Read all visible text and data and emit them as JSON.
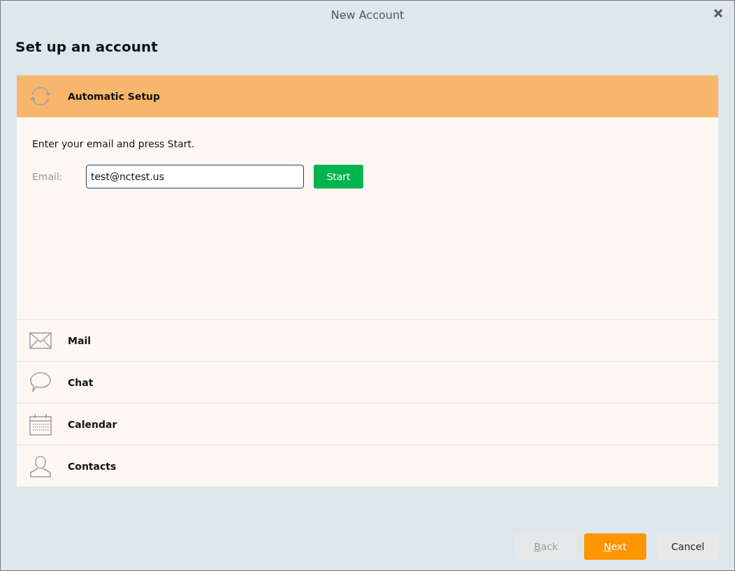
{
  "window": {
    "title": "New Account"
  },
  "heading": "Set up an account",
  "sections": [
    {
      "kind": "auto",
      "label": "Automatic Setup",
      "selected": true
    },
    {
      "kind": "mail",
      "label": "Mail",
      "selected": false
    },
    {
      "kind": "chat",
      "label": "Chat",
      "selected": false
    },
    {
      "kind": "calendar",
      "label": "Calendar",
      "selected": false
    },
    {
      "kind": "contacts",
      "label": "Contacts",
      "selected": false
    }
  ],
  "auto_setup": {
    "instruction": "Enter your email and press Start.",
    "email_label": "Email:",
    "email_value": "test@nctest.us",
    "start_button": "Start"
  },
  "buttons": [
    {
      "label": "Back",
      "kind": "back",
      "disabled": true,
      "underline_first": true
    },
    {
      "label": "Next",
      "kind": "primary",
      "disabled": false,
      "underline_first": true
    },
    {
      "label": "Cancel",
      "kind": "plain",
      "disabled": false,
      "underline_first": false
    }
  ]
}
